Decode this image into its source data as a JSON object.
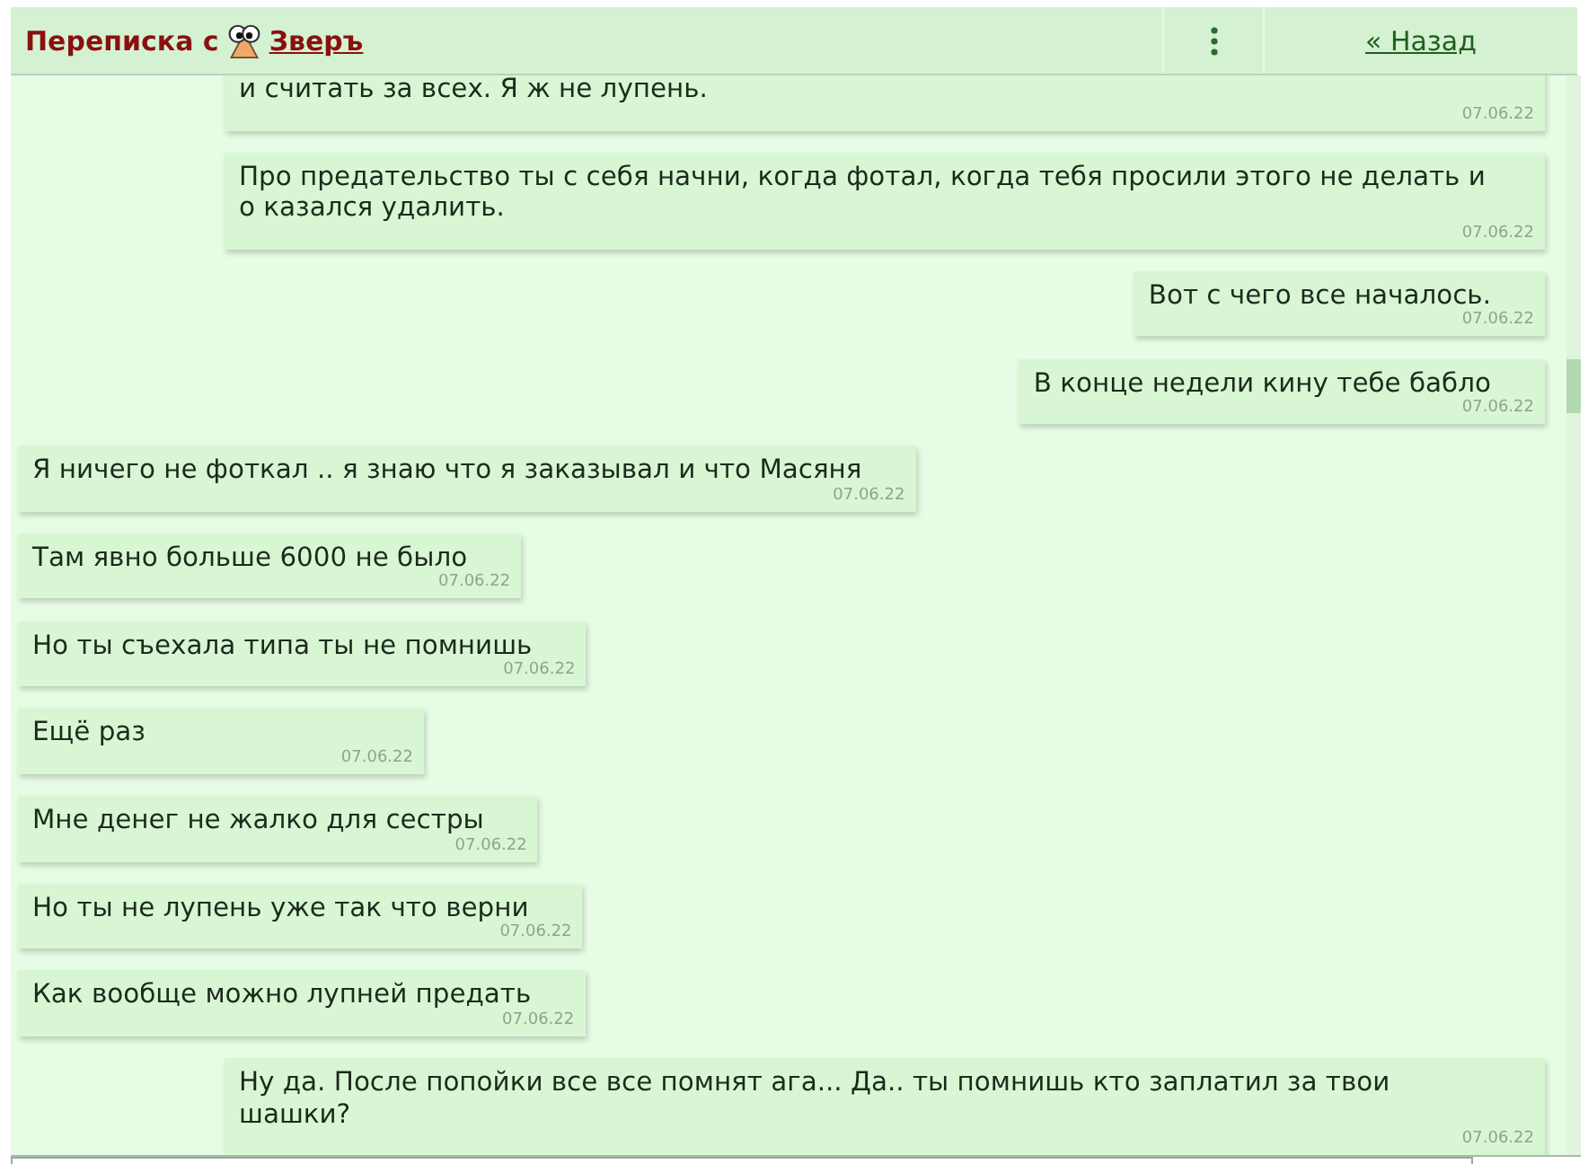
{
  "header": {
    "title": "Переписка с",
    "contact": "Зверъ",
    "back_link": "« Назад"
  },
  "messages": [
    {
      "kind": "sent",
      "clipped_top": true,
      "text": "и считать за всех. Я ж не лупень.",
      "date": "07.06.22"
    },
    {
      "kind": "sent",
      "clipped_top": false,
      "text": "Про предательство ты с себя начни, когда фотал, когда тебя просили этого не делать и о казался удалить.",
      "date": "07.06.22"
    },
    {
      "kind": "sent",
      "clipped_top": false,
      "text": "Вот с чего все началось.",
      "date": "07.06.22"
    },
    {
      "kind": "sent",
      "clipped_top": false,
      "text": "В конце недели кину тебе бабло",
      "date": "07.06.22"
    },
    {
      "kind": "received",
      "clipped_top": false,
      "text": "Я ничего не фоткал .. я знаю что я заказывал и что Масяня",
      "date": "07.06.22"
    },
    {
      "kind": "received",
      "clipped_top": false,
      "text": "Там явно больше 6000 не было",
      "date": "07.06.22"
    },
    {
      "kind": "received",
      "clipped_top": false,
      "text": "Но ты съехала типа ты не помнишь",
      "date": "07.06.22"
    },
    {
      "kind": "received",
      "clipped_top": false,
      "text": "Ещё раз",
      "date": "07.06.22"
    },
    {
      "kind": "received",
      "clipped_top": false,
      "text": "Мне денег не жалко для сестры",
      "date": "07.06.22"
    },
    {
      "kind": "received",
      "clipped_top": false,
      "text": "Но ты не лупень уже так что верни",
      "date": "07.06.22"
    },
    {
      "kind": "received",
      "clipped_top": false,
      "text": "Как вообще можно лупней предать",
      "date": "07.06.22"
    },
    {
      "kind": "sent",
      "clipped_top": false,
      "text": "Ну да. После попойки все все помнят ага... Да.. ты помнишь кто заплатил за твои шашки?",
      "date": "07.06.22"
    }
  ]
}
